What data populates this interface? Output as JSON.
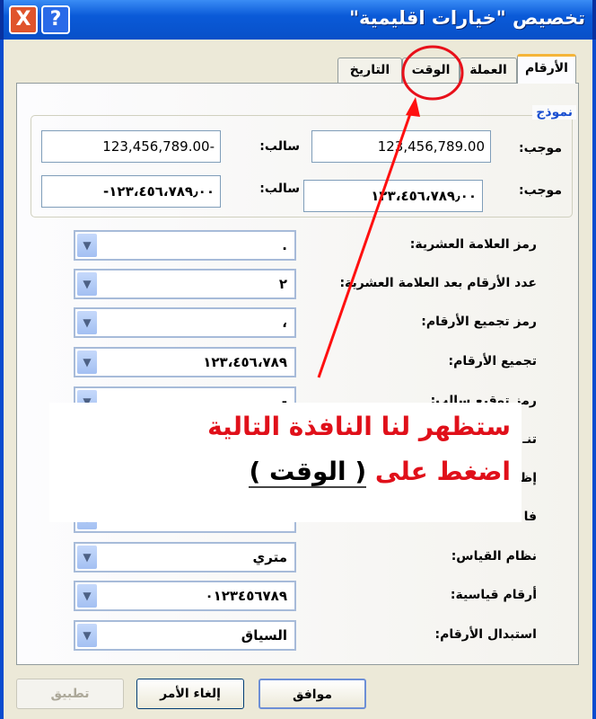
{
  "window": {
    "title": "تخصيص \"خيارات اقليمية\"",
    "help_icon": "?",
    "close_icon": "X"
  },
  "tabs": [
    {
      "label": "الأرقام",
      "active": true
    },
    {
      "label": "العملة"
    },
    {
      "label": "الوقت",
      "highlighted": true
    },
    {
      "label": "التاريخ"
    }
  ],
  "sample": {
    "title": "نموذج",
    "positive_label": "موجب:",
    "negative_label": "سالب:",
    "positive_latin": "123,456,789.00",
    "negative_latin": "123,456,789.00-",
    "positive_arabic": "١٢٣،٤٥٦،٧٨٩٫٠٠",
    "negative_arabic": "-١٢٣،٤٥٦،٧٨٩٫٠٠"
  },
  "settings": [
    {
      "label": "رمز العلامة العشرية:",
      "value": "."
    },
    {
      "label": "عدد الأرقام بعد العلامة العشرية:",
      "value": "٢"
    },
    {
      "label": "رمز تجميع الأرقام:",
      "value": "،"
    },
    {
      "label": "تجميع الأرقام:",
      "value": "١٢٣،٤٥٦،٧٨٩"
    },
    {
      "label": "رمز توقيع سالب:",
      "value": "-"
    },
    {
      "label": "تنـ"
    },
    {
      "label": "إظ"
    },
    {
      "label": "فا"
    },
    {
      "label": "نظام القياس:",
      "value": "متري"
    },
    {
      "label": "أرقام قياسية:",
      "value": "٠١٢٣٤٥٦٧٨٩"
    },
    {
      "label": "استبدال الأرقام:",
      "value": "السياق"
    }
  ],
  "buttons": {
    "ok": "موافق",
    "cancel": "إلغاء الأمر",
    "apply": "تطبيق"
  },
  "annotation": {
    "line1": "ستظهر لنا النافذة التالية",
    "line2_prefix": "اضغط على",
    "line2_open": "(",
    "line2_target": "الوقت",
    "line2_close": ")",
    "color": "#e0101a"
  }
}
